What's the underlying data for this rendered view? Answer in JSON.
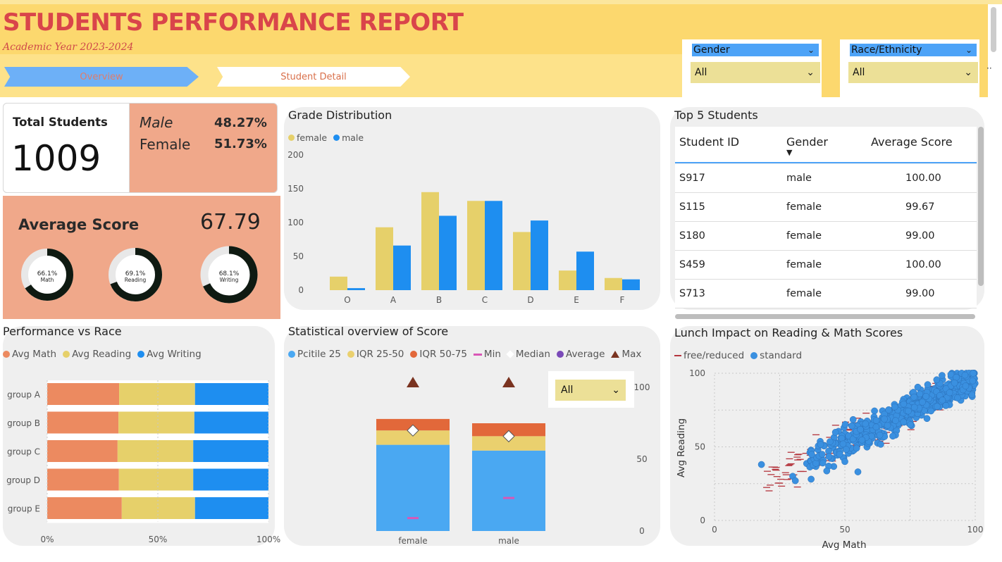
{
  "header": {
    "title": "STUDENTS PERFORMANCE REPORT",
    "subtitle": "Academic Year 2023-2024",
    "nav": {
      "overview": "Overview",
      "detail": "Student Detail"
    },
    "gender_slicer": {
      "label": "Gender",
      "value": "All"
    },
    "race_slicer": {
      "label": "Race/Ethnicity",
      "value": "All"
    }
  },
  "kpi": {
    "total_label": "Total Students",
    "total_value": "1009",
    "male_label": "Male",
    "male_pct": "48.27%",
    "female_label": "Female",
    "female_pct": "51.73%",
    "avg_label": "Average Score",
    "avg_value": "67.79",
    "donuts": [
      {
        "pct_text": "66.1%",
        "label": "Math",
        "pct": 66.1
      },
      {
        "pct_text": "69.1%",
        "label": "Reading",
        "pct": 69.1
      },
      {
        "pct_text": "68.1%",
        "label": "Writing",
        "pct": 68.1
      }
    ]
  },
  "grade": {
    "title": "Grade Distribution",
    "legend": [
      "female",
      "male"
    ],
    "chart_data": {
      "type": "bar",
      "categories": [
        "O",
        "A",
        "B",
        "C",
        "D",
        "E",
        "F"
      ],
      "series": [
        {
          "name": "female",
          "values": [
            20,
            93,
            145,
            132,
            86,
            29,
            18
          ]
        },
        {
          "name": "male",
          "values": [
            3,
            66,
            110,
            132,
            103,
            57,
            16
          ]
        }
      ],
      "ylim": [
        0,
        200
      ],
      "yticks": [
        "200",
        "150",
        "100",
        "50",
        "0"
      ]
    }
  },
  "top5": {
    "title": "Top 5 Students",
    "columns": [
      "Student ID",
      "Gender",
      "Average Score"
    ],
    "rows": [
      [
        "S917",
        "male",
        "100.00"
      ],
      [
        "S115",
        "female",
        "99.67"
      ],
      [
        "S180",
        "female",
        "99.00"
      ],
      [
        "S459",
        "female",
        "100.00"
      ],
      [
        "S713",
        "female",
        "99.00"
      ]
    ]
  },
  "race": {
    "title": "Performance vs Race",
    "legend": [
      "Avg Math",
      "Avg Reading",
      "Avg Writing"
    ],
    "chart_data": {
      "type": "bar",
      "categories": [
        "group A",
        "group B",
        "group C",
        "group D",
        "group E"
      ],
      "series": [
        {
          "name": "Avg Math",
          "values": [
            32.5,
            32.2,
            31.8,
            32.4,
            33.7
          ]
        },
        {
          "name": "Avg Reading",
          "values": [
            34.3,
            34.3,
            34.2,
            33.6,
            33.1
          ]
        },
        {
          "name": "Avg Writing",
          "values": [
            33.2,
            33.5,
            34.0,
            34.0,
            33.2
          ]
        }
      ],
      "xticks": [
        "0%",
        "50%",
        "100%"
      ]
    }
  },
  "stat": {
    "title": "Statistical overview of Score",
    "legend": [
      "Pcitile 25",
      "IQR 25-50",
      "IQR 50-75",
      "Min",
      "Median",
      "Average",
      "Max"
    ],
    "dropdown": "All",
    "chart_data": {
      "type": "bar",
      "categories": [
        "female",
        "male"
      ],
      "p25": [
        60,
        56
      ],
      "iqr_25_50": [
        10,
        10
      ],
      "iqr_50_75": [
        8,
        9
      ],
      "min": [
        9,
        23
      ],
      "median": [
        70,
        66
      ],
      "max": [
        100,
        100
      ],
      "ylim": [
        0,
        100
      ],
      "yticks": [
        "100",
        "50",
        "0"
      ]
    }
  },
  "lunch": {
    "title": "Lunch Impact on Reading & Math Scores",
    "legend": [
      "free/reduced",
      "standard"
    ],
    "xlabel": "Avg Math",
    "ylabel": "Avg Reading",
    "xticks": [
      "0",
      "50",
      "100"
    ],
    "yticks": [
      "100",
      "50",
      "0"
    ],
    "chart_data": {
      "type": "scatter",
      "xlim": [
        0,
        100
      ],
      "ylim": [
        0,
        100
      ]
    }
  },
  "colors": {
    "salmon": "#f0a88a",
    "female": "#e6d06a",
    "male": "#1e8ef0",
    "math": "#ec8a60",
    "reading": "#e6d06a",
    "writing": "#1e8ef0",
    "p25": "#4aa8f2",
    "iqr2": "#ead06e",
    "iqr3": "#e2683a",
    "min": "#d957b6",
    "max": "#7a3320",
    "free": "#b4353d",
    "standard": "#3a90e0"
  }
}
